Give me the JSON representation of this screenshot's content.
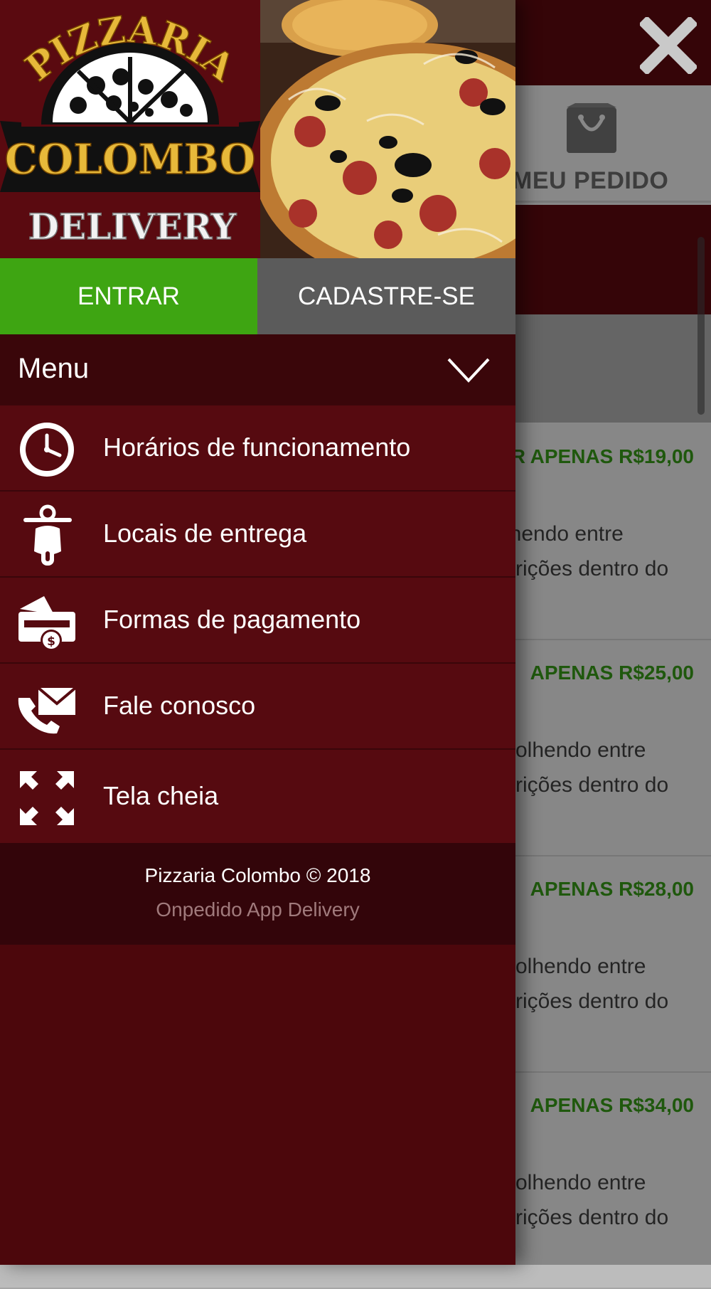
{
  "background_page": {
    "cart_label": "MEU PEDIDO",
    "items": [
      {
        "price_text": "R APENAS R$19,00",
        "desc_line1": "lhendo entre",
        "desc_line2": "crições dentro do"
      },
      {
        "price_text": "APENAS R$25,00",
        "desc_line1": "colhendo entre",
        "desc_line2": "crições dentro do"
      },
      {
        "price_text": "APENAS R$28,00",
        "desc_line1": "colhendo entre",
        "desc_line2": "crições dentro do"
      },
      {
        "price_text": "APENAS R$34,00",
        "desc_line1": "colhendo entre",
        "desc_line2": "crições dentro do"
      }
    ]
  },
  "drawer": {
    "logo": {
      "line1": "PIZZARIA",
      "line2": "COLOMBO",
      "line3": "DELIVERY"
    },
    "login_label": "ENTRAR",
    "register_label": "CADASTRE-SE",
    "menu_title": "Menu",
    "menu_items": [
      {
        "label": "Horários de funcionamento",
        "icon": "clock-icon"
      },
      {
        "label": "Locais de entrega",
        "icon": "scooter-icon"
      },
      {
        "label": "Formas de pagamento",
        "icon": "payment-icon"
      },
      {
        "label": "Fale conosco",
        "icon": "contact-icon"
      },
      {
        "label": "Tela cheia",
        "icon": "fullscreen-icon"
      }
    ],
    "footer_copyright": "Pizzaria Colombo © 2018",
    "footer_brand": "Onpedido App Delivery"
  },
  "colors": {
    "drawer_bg": "#4c070c",
    "menu_item_bg": "#560a10",
    "login_green": "#3ea512",
    "register_grey": "#5b5b5b",
    "price_green": "#2c7a12"
  }
}
